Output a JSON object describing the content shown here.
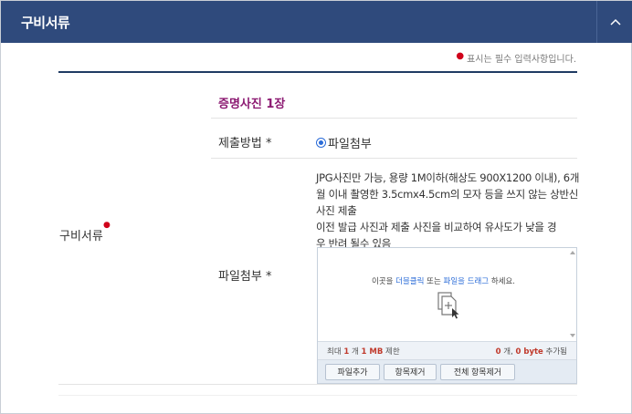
{
  "panel": {
    "title": "구비서류",
    "collapse_icon": "chevron-up-icon"
  },
  "required_note": "표시는 필수 입력사항입니다.",
  "form": {
    "row_label": "구비서류",
    "section_title": "증명사진 1장",
    "method": {
      "label": "제출방법 *",
      "option_label": "파일첨부",
      "selected": true
    },
    "attach": {
      "label": "파일첨부 *",
      "instructions": {
        "line1": "JPG사진만 가능, 용량 1M이하(해상도 900X1200 이내), 6개",
        "line2": "월 이내 촬영한 3.5cmx4.5cm의 모자 등을 쓰지 않는 상반신",
        "line3": "사진 제출",
        "line4": "이전 발급 사진과 제출 사진을 비교하여 유사도가 낮을 경",
        "line5": "우 반려 될수 있음"
      }
    }
  },
  "uploader": {
    "drop_prefix": "이곳을 ",
    "drop_dblclick": "더블클릭",
    "drop_or": " 또는 ",
    "drop_drag": "파일을 드래그",
    "drop_suffix": " 하세요.",
    "limit_prefix": "최대 ",
    "limit_count": "1",
    "limit_mid": " 개 ",
    "limit_size": "1 MB",
    "limit_suffix": " 제한",
    "status_count": "0",
    "status_mid": " 개, ",
    "status_size": "0 byte",
    "status_suffix": " 추가됨",
    "buttons": {
      "add": "파일추가",
      "remove": "항목제거",
      "remove_all": "전체 항목제거"
    }
  }
}
